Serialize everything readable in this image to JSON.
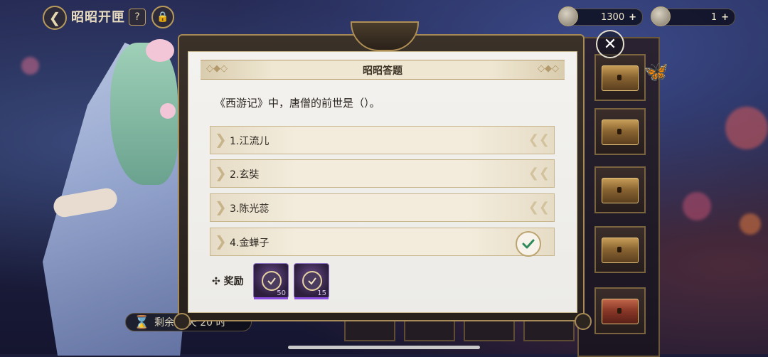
{
  "header": {
    "back_icon": "back-arrow-icon",
    "title": "昭昭开匣",
    "help_label": "?",
    "lock_icon": "lock-icon"
  },
  "currencies": [
    {
      "icon": "coin-icon",
      "value": "1300",
      "plus": "+"
    },
    {
      "icon": "token-icon",
      "value": "1",
      "plus": "+"
    }
  ],
  "modal": {
    "title": "昭昭答题",
    "question": "《西游记》中，唐僧的前世是（）。",
    "options": [
      {
        "label": "1.江流儿"
      },
      {
        "label": "2.玄奘"
      },
      {
        "label": "3.陈光蕊"
      },
      {
        "label": "4.金蝉子",
        "selected": true
      }
    ],
    "reward_label": "奖励",
    "rewards": [
      {
        "icon": "answer-check-icon",
        "count": "50"
      },
      {
        "icon": "answer-check-icon",
        "count": "15"
      }
    ],
    "close_label": "✕"
  },
  "timer": {
    "text": "剩余 6 天 20 时"
  },
  "colors": {
    "accent": "#b99b5b",
    "correct": "#2e8a5a",
    "panel": "#f3f2ef"
  }
}
